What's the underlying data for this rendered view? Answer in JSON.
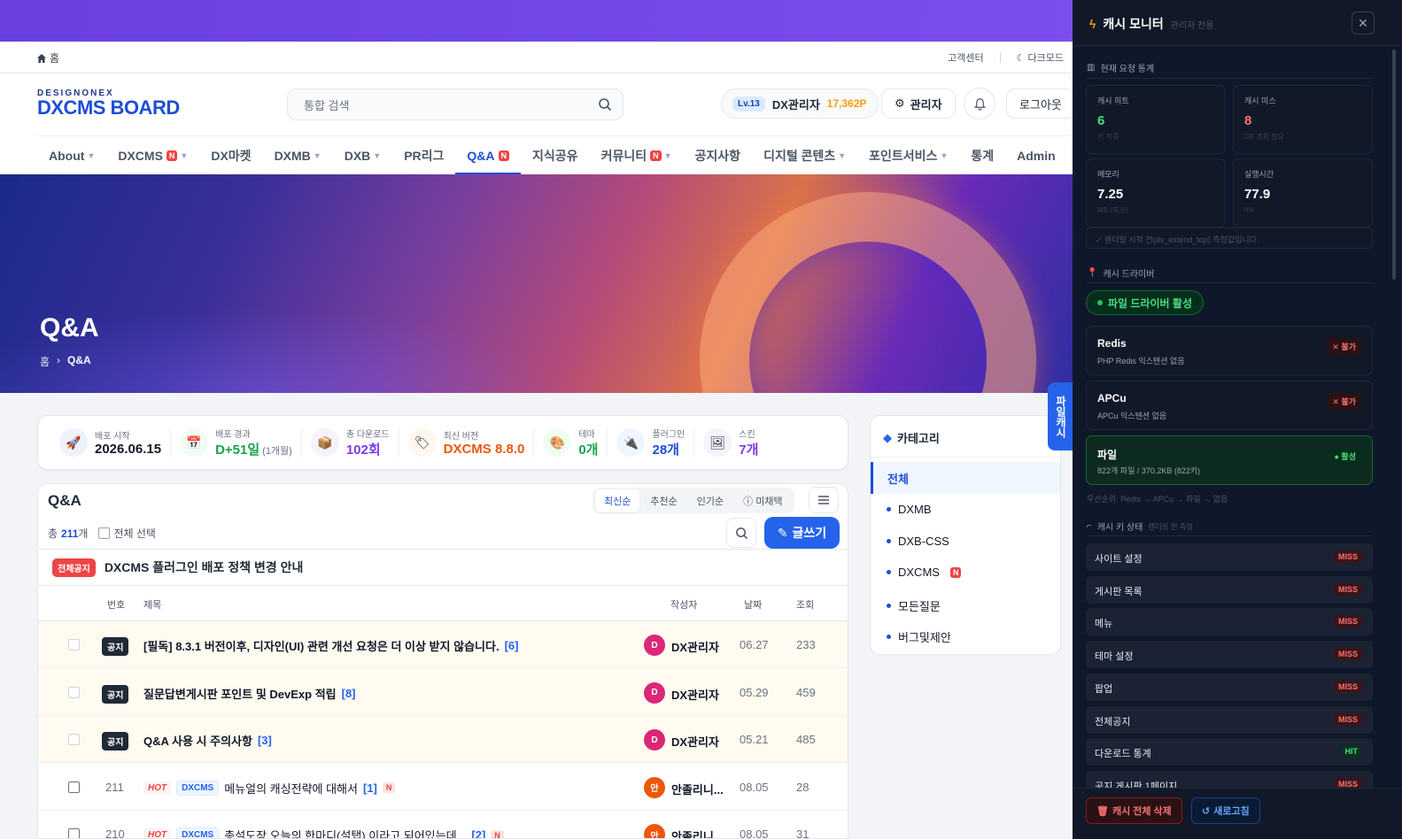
{
  "util": {
    "home": "홈",
    "support": "고객센터",
    "darkmode": "다크모드"
  },
  "logo": {
    "top": "DESIGNONEX",
    "main": "DXCMS BOARD"
  },
  "search": {
    "placeholder": "통합 검색"
  },
  "user": {
    "level": "Lv.13",
    "name": "DX관리자",
    "points": "17,362P"
  },
  "buttons": {
    "admin": "관리자",
    "logout": "로그아웃"
  },
  "nav": [
    {
      "label": "About",
      "caret": true
    },
    {
      "label": "DXCMS",
      "badge": "N",
      "caret": true
    },
    {
      "label": "DX마켓"
    },
    {
      "label": "DXMB",
      "caret": true
    },
    {
      "label": "DXB",
      "caret": true
    },
    {
      "label": "PR리그"
    },
    {
      "label": "Q&A",
      "badge": "N",
      "active": true
    },
    {
      "label": "지식공유"
    },
    {
      "label": "커뮤니티",
      "badge": "N",
      "caret": true
    },
    {
      "label": "공지사항"
    },
    {
      "label": "디지털 콘텐츠",
      "caret": true
    },
    {
      "label": "포인트서비스",
      "caret": true
    },
    {
      "label": "통계"
    },
    {
      "label": "Admin"
    }
  ],
  "hero": {
    "title": "Q&A",
    "crumb_home": "홈",
    "crumb_current": "Q&A"
  },
  "stats": [
    {
      "label": "배포 시작",
      "value": "2026.06.15",
      "icon": "rocket-icon",
      "color": "#111827",
      "bg": "#eef2ff",
      "glyph": "🚀"
    },
    {
      "label": "배포 경과",
      "value": "D+51일",
      "sub": "(1개월)",
      "icon": "calendar-icon",
      "color": "#16a34a",
      "bg": "#f0fdf4",
      "glyph": "📅"
    },
    {
      "label": "총 다운로드",
      "value": "102회",
      "icon": "box-icon",
      "color": "#7c3aed",
      "bg": "#f5f3ff",
      "glyph": "📦"
    },
    {
      "label": "최신 버전",
      "value": "DXCMS 8.8.0",
      "icon": "tag-icon",
      "color": "#ea580c",
      "bg": "#fff7ed",
      "glyph": "🏷"
    },
    {
      "label": "테마",
      "value": "0개",
      "icon": "palette-icon",
      "color": "#16a34a",
      "bg": "#f0fdf4",
      "glyph": "🎨"
    },
    {
      "label": "플러그인",
      "value": "28개",
      "icon": "plug-icon",
      "color": "#1d4ed8",
      "bg": "#eff6ff",
      "glyph": "🔌"
    },
    {
      "label": "스킨",
      "value": "7개",
      "icon": "image-icon",
      "color": "#7c3aed",
      "bg": "#f5f3ff",
      "glyph": "🖼"
    }
  ],
  "board": {
    "title": "Q&A",
    "sort_tabs": [
      "최신순",
      "추천순",
      "인기순",
      "미채택"
    ],
    "total_prefix": "총",
    "total_count": "211",
    "total_suffix": "개",
    "select_all": "전체 선택",
    "write": "글쓰기",
    "global_notice_badge": "전체공지",
    "global_notice": "DXCMS 플러그인 배포 정책 변경 안내",
    "columns": {
      "num": "번호",
      "title": "제목",
      "author": "작성자",
      "date": "날짜",
      "views": "조회"
    },
    "rows": [
      {
        "type": "notice",
        "tag": "공지",
        "title": "[필독] 8.3.1 버전이후, 디자인(UI) 관련 개선 요청은 더 이상 받지 않습니다.",
        "comments": "[6]",
        "avatar": "D",
        "avatar_color": "#db2777",
        "author": "DX관리자",
        "date": "06.27",
        "views": "233"
      },
      {
        "type": "notice",
        "tag": "공지",
        "title": "질문답변게시판 포인트 및 DevExp 적립",
        "comments": "[8]",
        "avatar": "D",
        "avatar_color": "#db2777",
        "author": "DX관리자",
        "date": "05.29",
        "views": "459"
      },
      {
        "type": "notice",
        "tag": "공지",
        "title": "Q&A 사용 시 주의사항",
        "comments": "[3]",
        "avatar": "D",
        "avatar_color": "#db2777",
        "author": "DX관리자",
        "date": "05.21",
        "views": "485"
      },
      {
        "type": "normal",
        "num": "211",
        "hot": "HOT",
        "cat": "DXCMS",
        "title": "메뉴얼의 캐싱전략에 대해서",
        "comments": "[1]",
        "new": "N",
        "avatar": "안",
        "avatar_color": "#ea580c",
        "author": "안졸리니...",
        "date": "08.05",
        "views": "28"
      },
      {
        "type": "normal",
        "num": "210",
        "hot": "HOT",
        "cat": "DXCMS",
        "title": "총설도장 오늘의 한마디(설탭) 이라고 되어있는데...",
        "comments": "[2]",
        "new": "N",
        "avatar": "안",
        "avatar_color": "#ea580c",
        "author": "안졸리니...",
        "date": "08.05",
        "views": "31"
      }
    ]
  },
  "category": {
    "title": "카테고리",
    "all": "전체",
    "items": [
      {
        "label": "DXMB"
      },
      {
        "label": "DXB-CSS"
      },
      {
        "label": "DXCMS",
        "badge": "N"
      },
      {
        "label": "모든질문"
      },
      {
        "label": "버그및제안"
      }
    ]
  },
  "side_tab": {
    "line1": "파일",
    "line2": "캐시"
  },
  "cache": {
    "title": "캐시 모니터",
    "subtitle": "관리자 전용",
    "section_stats": "현재 요청 통계",
    "metrics": [
      {
        "label": "캐시 히트",
        "value": "6",
        "sub": "키 적중",
        "color": "#4ade80"
      },
      {
        "label": "캐시 미스",
        "value": "8",
        "sub": "DB 조회 필요",
        "color": "#f87171"
      },
      {
        "label": "메모리",
        "value": "7.25",
        "sub": "MB (피크)",
        "color": "#ffffff"
      },
      {
        "label": "실행시간",
        "value": "77.9",
        "sub": "ms",
        "color": "#ffffff"
      }
    ],
    "note": "✓ 렌더링 시작 전(dx_extend_top) 측정값입니다.",
    "section_driver": "캐시 드라이버",
    "active_driver": "파일 드라이버 활성",
    "drivers": [
      {
        "name": "Redis",
        "desc": "PHP Redis 익스텐션 없음",
        "status": "✕ 불가",
        "on": false
      },
      {
        "name": "APCu",
        "desc": "APCu 익스텐션 없음",
        "status": "✕ 불가",
        "on": false
      },
      {
        "name": "파일",
        "desc": "822개 파일 / 370.2KB (822키)",
        "status": "● 활성",
        "on": true
      }
    ],
    "priority": "우선순위: Redis → APCu → 파일 → 없음",
    "section_keys": "캐시 키 상태",
    "section_keys_sub": "렌더링 전 측정",
    "keys": [
      {
        "label": "사이트 설정",
        "status": "MISS"
      },
      {
        "label": "게시판 목록",
        "status": "MISS"
      },
      {
        "label": "메뉴",
        "status": "MISS"
      },
      {
        "label": "테마 설정",
        "status": "MISS"
      },
      {
        "label": "팝업",
        "status": "MISS"
      },
      {
        "label": "전체공지",
        "status": "MISS"
      },
      {
        "label": "다운로드 통계",
        "status": "HIT"
      },
      {
        "label": "공지 게시판 1페이지",
        "status": "MISS"
      }
    ],
    "clear_all": "캐시 전체 삭제",
    "refresh": "새로고침"
  }
}
